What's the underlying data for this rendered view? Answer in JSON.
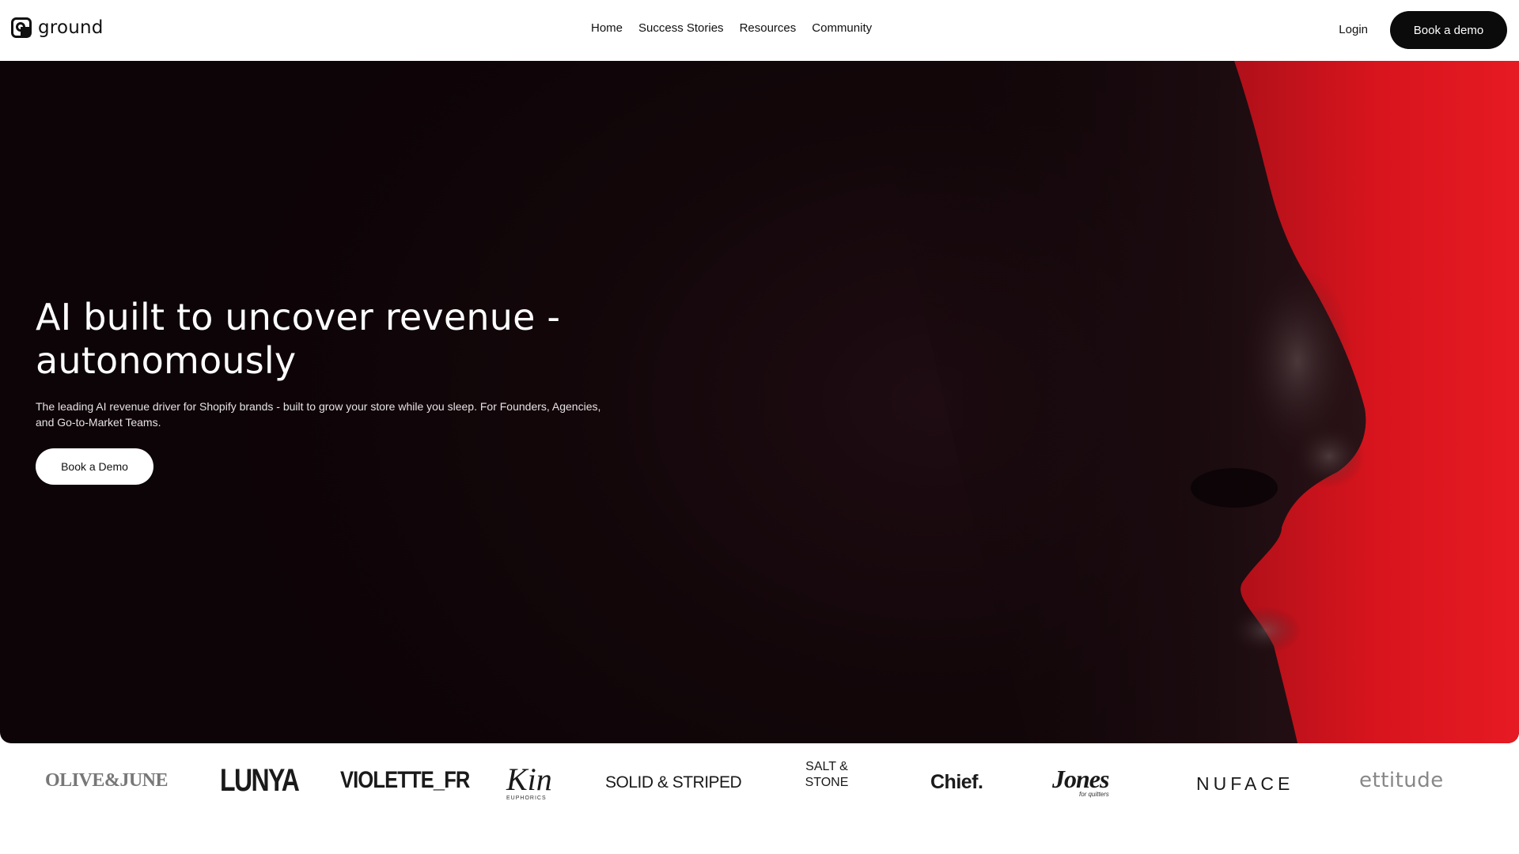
{
  "header": {
    "logo_text": "ground",
    "nav": [
      "Home",
      "Success Stories",
      "Resources",
      "Community"
    ],
    "login_label": "Login",
    "cta_label": "Book a demo"
  },
  "hero": {
    "title": "AI built to uncover revenue - autonomously",
    "subtitle": "The leading AI revenue driver for Shopify brands - built to grow your store while you sleep. For Founders, Agencies, and Go-to-Market Teams.",
    "cta_label": "Book a Demo",
    "accent_color": "#e8141c"
  },
  "brand_logos": {
    "olive_june": "OLIVE&JUNE",
    "lunya": "LUNYA",
    "violette": "VIOLETTE_FR",
    "kin": "Kin",
    "kin_sub": "EUPHORICS",
    "solid_striped": "SOLID & STRIPED",
    "salt_stone": "SALT & STONE",
    "chief": "Chief.",
    "jones": "Jones",
    "jones_sub": "for quitters",
    "nuface": "NUFACE",
    "ettitude": "ettitude"
  }
}
